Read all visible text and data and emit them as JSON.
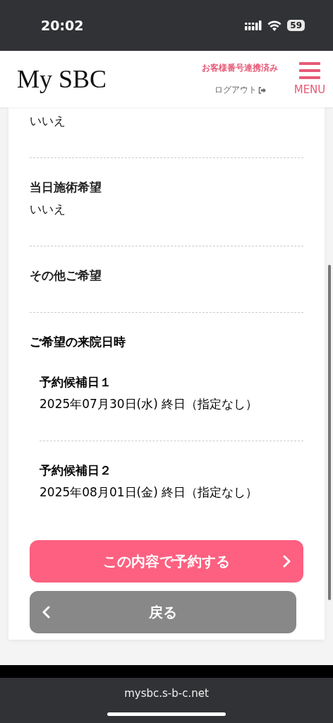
{
  "status_bar": {
    "time": "20:02",
    "battery": "59"
  },
  "header": {
    "logo": "My SBC",
    "link_status": "お客様番号連携済み",
    "logout": "ログアウト",
    "menu": "MENU"
  },
  "fields": [
    {
      "value": "いいえ"
    },
    {
      "label": "当日施術希望",
      "value": "いいえ"
    },
    {
      "label": "その他ご希望"
    }
  ],
  "preferred_dates": {
    "label": "ご希望の来院日時",
    "candidates": [
      {
        "label": "予約候補日１",
        "value": "2025年07月30日(水) 終日（指定なし）"
      },
      {
        "label": "予約候補日２",
        "value": "2025年08月01日(金) 終日（指定なし）"
      }
    ]
  },
  "buttons": [
    {
      "kind": "primary",
      "label": "この内容で予約する"
    },
    {
      "kind": "back",
      "label": "戻る"
    }
  ],
  "browser": {
    "url": "mysbc.s-b-c.net"
  }
}
